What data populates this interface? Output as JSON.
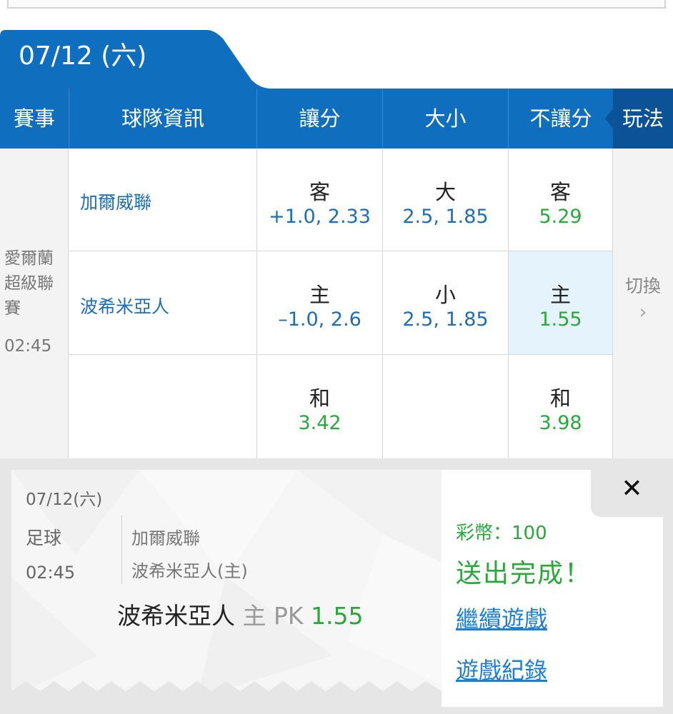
{
  "date": "07/12 (六)",
  "headers": {
    "event": "賽事",
    "team_info": "球隊資訊",
    "handicap": "讓分",
    "over_under": "大小",
    "moneyline": "不讓分",
    "play": "玩法"
  },
  "match": {
    "league_lines": [
      "愛爾蘭",
      "超級聯",
      "賽"
    ],
    "time": "02:45",
    "away_team": "加爾威聯",
    "home_team": "波希米亞人",
    "rows": [
      {
        "handicap": {
          "label": "客",
          "value": "+1.0, 2.33"
        },
        "over_under": {
          "label": "大",
          "value": "2.5, 1.85"
        },
        "moneyline": {
          "label": "客",
          "value": "5.29"
        }
      },
      {
        "handicap": {
          "label": "主",
          "value": "–1.0, 2.6"
        },
        "over_under": {
          "label": "小",
          "value": "2.5, 1.85"
        },
        "moneyline": {
          "label": "主",
          "value": "1.55"
        }
      },
      {
        "handicap": {
          "label": "和",
          "value": "3.42"
        },
        "moneyline": {
          "label": "和",
          "value": "3.98"
        }
      }
    ],
    "switch_label": "切換",
    "switch_chevron": "›"
  },
  "ticket": {
    "date": "07/12(六)",
    "sport": "足球",
    "time": "02:45",
    "team1": "加爾威聯",
    "team2": "波希米亞人(主)",
    "pick_team": "波希米亞人",
    "pick_side": "主 PK",
    "pick_odds": "1.55"
  },
  "result": {
    "close_icon": "✕",
    "stake": "彩幣：100",
    "status": "送出完成！",
    "continue_link": "繼續遊戲",
    "history_link": "遊戲紀錄"
  },
  "colors": {
    "header_blue": "#0f6fbe",
    "play_dark_blue": "#0b5296",
    "odds_green": "#2aa83a",
    "team_blue": "#1c6fb2",
    "selected_bg": "#e4f3fc"
  }
}
